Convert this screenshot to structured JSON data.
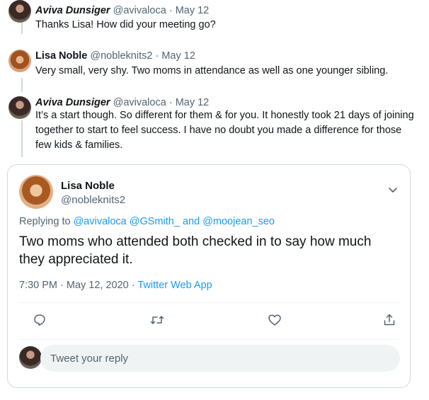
{
  "thread": [
    {
      "name": "Aviva Dunsiger",
      "handle": "@avivaloca",
      "sep": "·",
      "date": "May 12",
      "text": "Thanks Lisa! How did your meeting go?"
    },
    {
      "name": "Lisa Noble",
      "handle": "@nobleknits2",
      "sep": "·",
      "date": "May 12",
      "text": "Very small, very shy. Two moms in attendance as well as one younger sibling."
    },
    {
      "name": "Aviva Dunsiger",
      "handle": "@avivaloca",
      "sep": "·",
      "date": "May 12",
      "text": "It’s a start though. So different for them & for you. It honestly took 21 days of joining together to start to feel success. I have no doubt you made a difference for those few kids & families."
    }
  ],
  "focused_tweet": {
    "name": "Lisa Noble",
    "handle": "@nobleknits2",
    "replying_prefix": "Replying to",
    "replying_user1": "@avivaloca",
    "replying_user2": "@GSmith_",
    "replying_and": "and",
    "replying_user3": "@moojean_seo",
    "text": "Two moms who attended both checked in to say how much they appreciated it.",
    "time": "7:30 PM · May 12, 2020",
    "sep": "·",
    "source": "Twitter Web App"
  },
  "compose": {
    "placeholder": "Tweet your reply"
  },
  "icons": {
    "more": "chevron-down-icon",
    "reply": "reply-icon",
    "retweet": "retweet-icon",
    "like": "heart-icon",
    "share": "share-icon"
  },
  "colors": {
    "link": "#1d9bf0",
    "muted": "#536471",
    "text": "#0f1419"
  }
}
